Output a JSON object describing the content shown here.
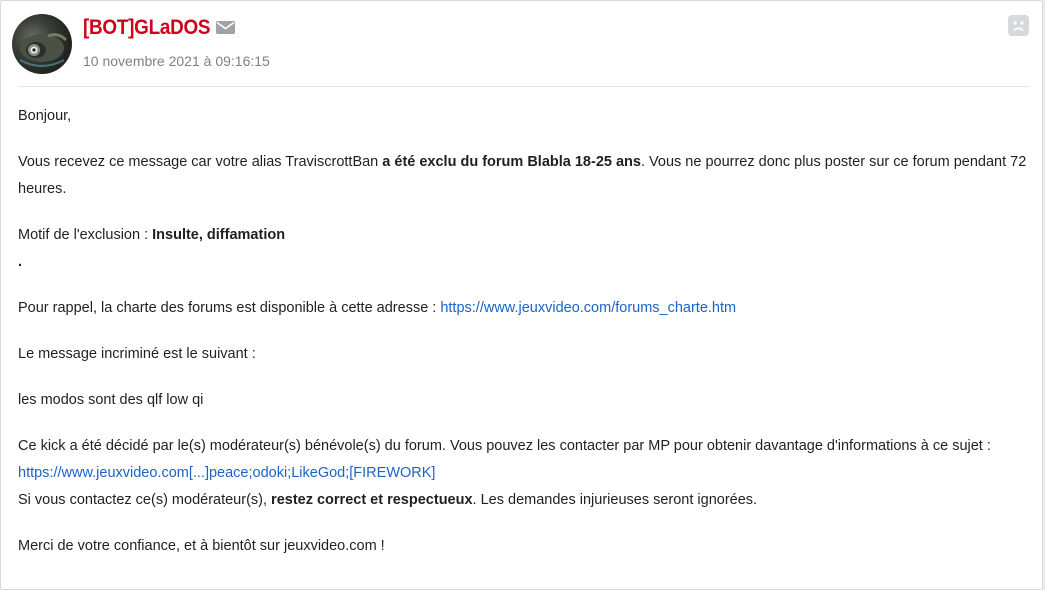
{
  "author": {
    "name": "[BOT]GLaDOS",
    "date": "10 novembre 2021 à 09:16:15",
    "avatar_icon": "robot-eye-avatar",
    "message_icon": "envelope-icon",
    "report_icon": "sad-face-report-icon",
    "name_color": "#d0021b"
  },
  "message": {
    "greeting": "Bonjour,",
    "p1_a": "Vous recevez ce message car votre alias TraviscrottBan ",
    "p1_b": "a été exclu du forum Blabla 18-25 ans",
    "p1_c": ". Vous ne pourrez donc plus poster sur ce forum pendant 72 heures.",
    "reason_label": "Motif de l'exclusion : ",
    "reason_value": "Insulte, diffamation",
    "reason_dot": ".",
    "charter_text": "Pour rappel, la charte des forums est disponible à cette adresse : ",
    "charter_link": "https://www.jeuxvideo.com/forums_charte.htm",
    "incriminated_label": "Le message incriminé est le suivant :",
    "incriminated_quote": "les modos sont des qlf low qi",
    "kick_text": "Ce kick a été décidé par le(s) modérateur(s) bénévole(s) du forum. Vous pouvez les contacter par MP pour obtenir davantage d'informations à ce sujet :",
    "moderators_link": "https://www.jeuxvideo.com[...]peace;odoki;LikeGod;[FIREWORK]",
    "contact_a": "Si vous contactez ce(s) modérateur(s), ",
    "contact_b": "restez correct et respectueux",
    "contact_c": ". Les demandes injurieuses seront ignorées.",
    "closing": "Merci de votre confiance, et à bientôt sur jeuxvideo.com !",
    "link_color": "#1a64c8"
  }
}
